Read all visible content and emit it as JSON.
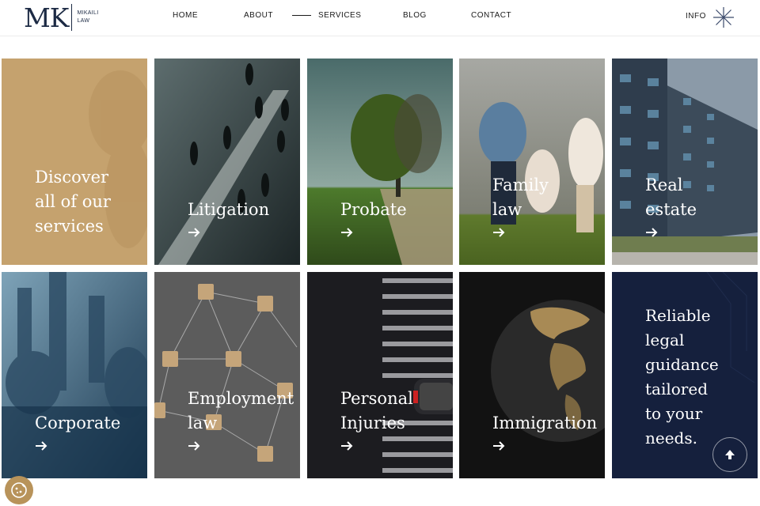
{
  "logo": {
    "mark": "MK",
    "sub_line1": "MIKAILI",
    "sub_line2": "LAW"
  },
  "nav": {
    "home": "HOME",
    "about": "ABOUT",
    "services": "SERVICES",
    "blog": "BLOG",
    "contact": "CONTACT",
    "info": "INFO"
  },
  "tiles": {
    "intro": {
      "line1": "Discover",
      "line2": "all of our",
      "line3": "services"
    },
    "litigation": {
      "line1": "Litigation"
    },
    "probate": {
      "line1": "Probate"
    },
    "family": {
      "line1": "Family",
      "line2": "law"
    },
    "real_estate": {
      "line1": "Real",
      "line2": "estate"
    },
    "corporate": {
      "line1": "Corporate"
    },
    "employment": {
      "line1": "Employment",
      "line2": "law"
    },
    "personal": {
      "line1": "Personal",
      "line2": "Injuries"
    },
    "immigration": {
      "line1": "Immigration"
    },
    "tagline": {
      "line1": "Reliable",
      "line2": "legal",
      "line3": "guidance",
      "line4": "tailored",
      "line5": "to your",
      "line6": "needs."
    }
  },
  "icons": {
    "info": "asterisk-icon",
    "arrow": "arrow-right-icon",
    "scroll_top": "arrow-up-icon",
    "cookie": "cookie-icon"
  },
  "colors": {
    "navy": "#1c2a44",
    "gold": "#c6a46f",
    "tagline_bg": "#15203d"
  }
}
